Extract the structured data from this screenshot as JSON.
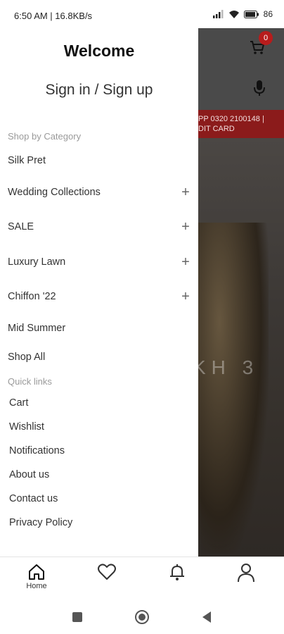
{
  "status_bar": {
    "time_speed": "6:50 AM | 16.8KB/s",
    "battery": "86"
  },
  "background_page": {
    "cart_count": "0",
    "promo_line1": "PP 0320 2100148 |",
    "promo_line2": "DIT CARD",
    "hero_text": "KH 3"
  },
  "drawer": {
    "welcome": "Welcome",
    "signin": "Sign in / Sign up",
    "shop_by_category_label": "Shop by Category",
    "categories": [
      {
        "label": "Silk Pret",
        "expandable": false
      },
      {
        "label": "Wedding Collections",
        "expandable": true
      },
      {
        "label": "SALE",
        "expandable": true
      },
      {
        "label": "Luxury Lawn",
        "expandable": true
      },
      {
        "label": "Chiffon '22",
        "expandable": true
      },
      {
        "label": "Mid Summer",
        "expandable": false
      },
      {
        "label": "Shop All",
        "expandable": false
      }
    ],
    "quick_links_label": "Quick links",
    "quick_links": [
      "Cart",
      "Wishlist",
      "Notifications",
      "About us",
      "Contact us",
      "Privacy Policy"
    ],
    "expand_symbol": "+"
  },
  "bottom_nav": {
    "home_label": "Home"
  },
  "colors": {
    "accent_red": "#8b1b1b",
    "badge_red": "#b71c1c"
  }
}
